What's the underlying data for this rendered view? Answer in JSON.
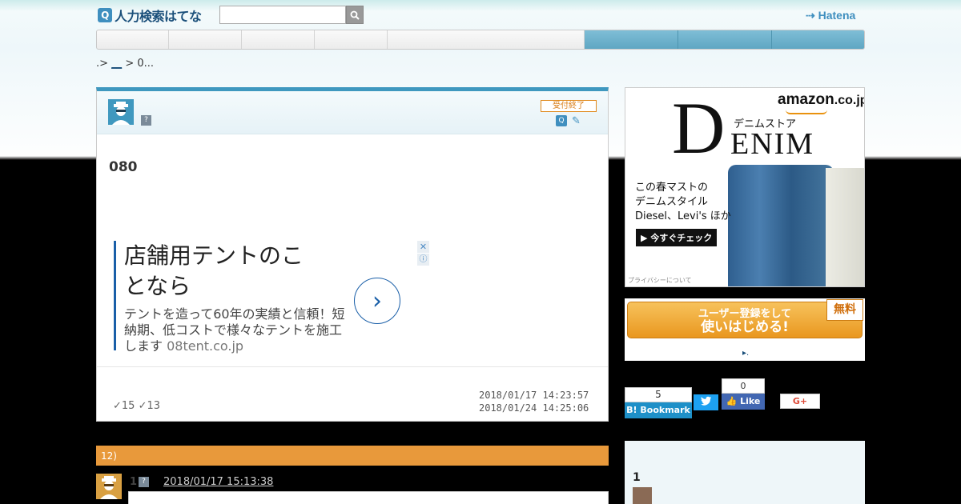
{
  "header": {
    "logo_glyph": "Q",
    "logo_text": "人力検索はてな",
    "search": {
      "placeholder": "",
      "value": ""
    },
    "hatena_logo": "Hatena"
  },
  "nav": {
    "items": [
      "",
      "",
      "",
      "",
      "",
      "",
      "",
      ""
    ]
  },
  "breadcrumb": {
    "lead": ".>",
    "link": "__",
    "sep": ">",
    "current": "0..."
  },
  "question": {
    "status": "受付終了",
    "help_glyph": "?",
    "q_glyph": "Q",
    "title": "080",
    "posted_at": "2018/01/17 14:23:57",
    "closed_at": "2018/01/24 14:25:06",
    "stat_1": "15",
    "stat_2": "13"
  },
  "ad": {
    "title": "店舗用テントのことなら",
    "description": "テントを造って60年の実績と信頼！短納期、低コストで様々なテントを施工します",
    "domain": "08tent.co.jp",
    "close_glyph": "✕",
    "info_glyph": "ⓘ",
    "arrow_glyph": "›"
  },
  "answers": {
    "header": "12)",
    "first": {
      "number": "1",
      "help_glyph": "?",
      "date": "2018/01/17 15:13:38"
    }
  },
  "sidebar": {
    "amazon": {
      "logo": "amazon",
      "logo_suffix": ".co.jp",
      "headline_initial": "D",
      "headline_store": "デニムストア",
      "headline_rest": "ENIM",
      "copy_1": "この春マストの",
      "copy_2": "デニムスタイル",
      "copy_3": "Diesel、Levi's ほか",
      "cta": "▶ 今すぐチェック",
      "privacy": "プライバシーについて"
    },
    "register": {
      "line_1": "ユーザー登録をして",
      "line_2": "使いはじめる!",
      "free_badge": "無料",
      "link": "▸."
    },
    "social": {
      "bookmark_count": "5",
      "bookmark_label": "B! Bookmark",
      "twitter_glyph": "🐦",
      "fb_count": "0",
      "fb_label": "👍 Like",
      "gplus_label": "G+"
    },
    "ranking": {
      "number": "1"
    }
  },
  "colors": {
    "accent_blue": "#3f98bf",
    "answer_orange": "#e8993b",
    "status_orange": "#d87a12"
  }
}
